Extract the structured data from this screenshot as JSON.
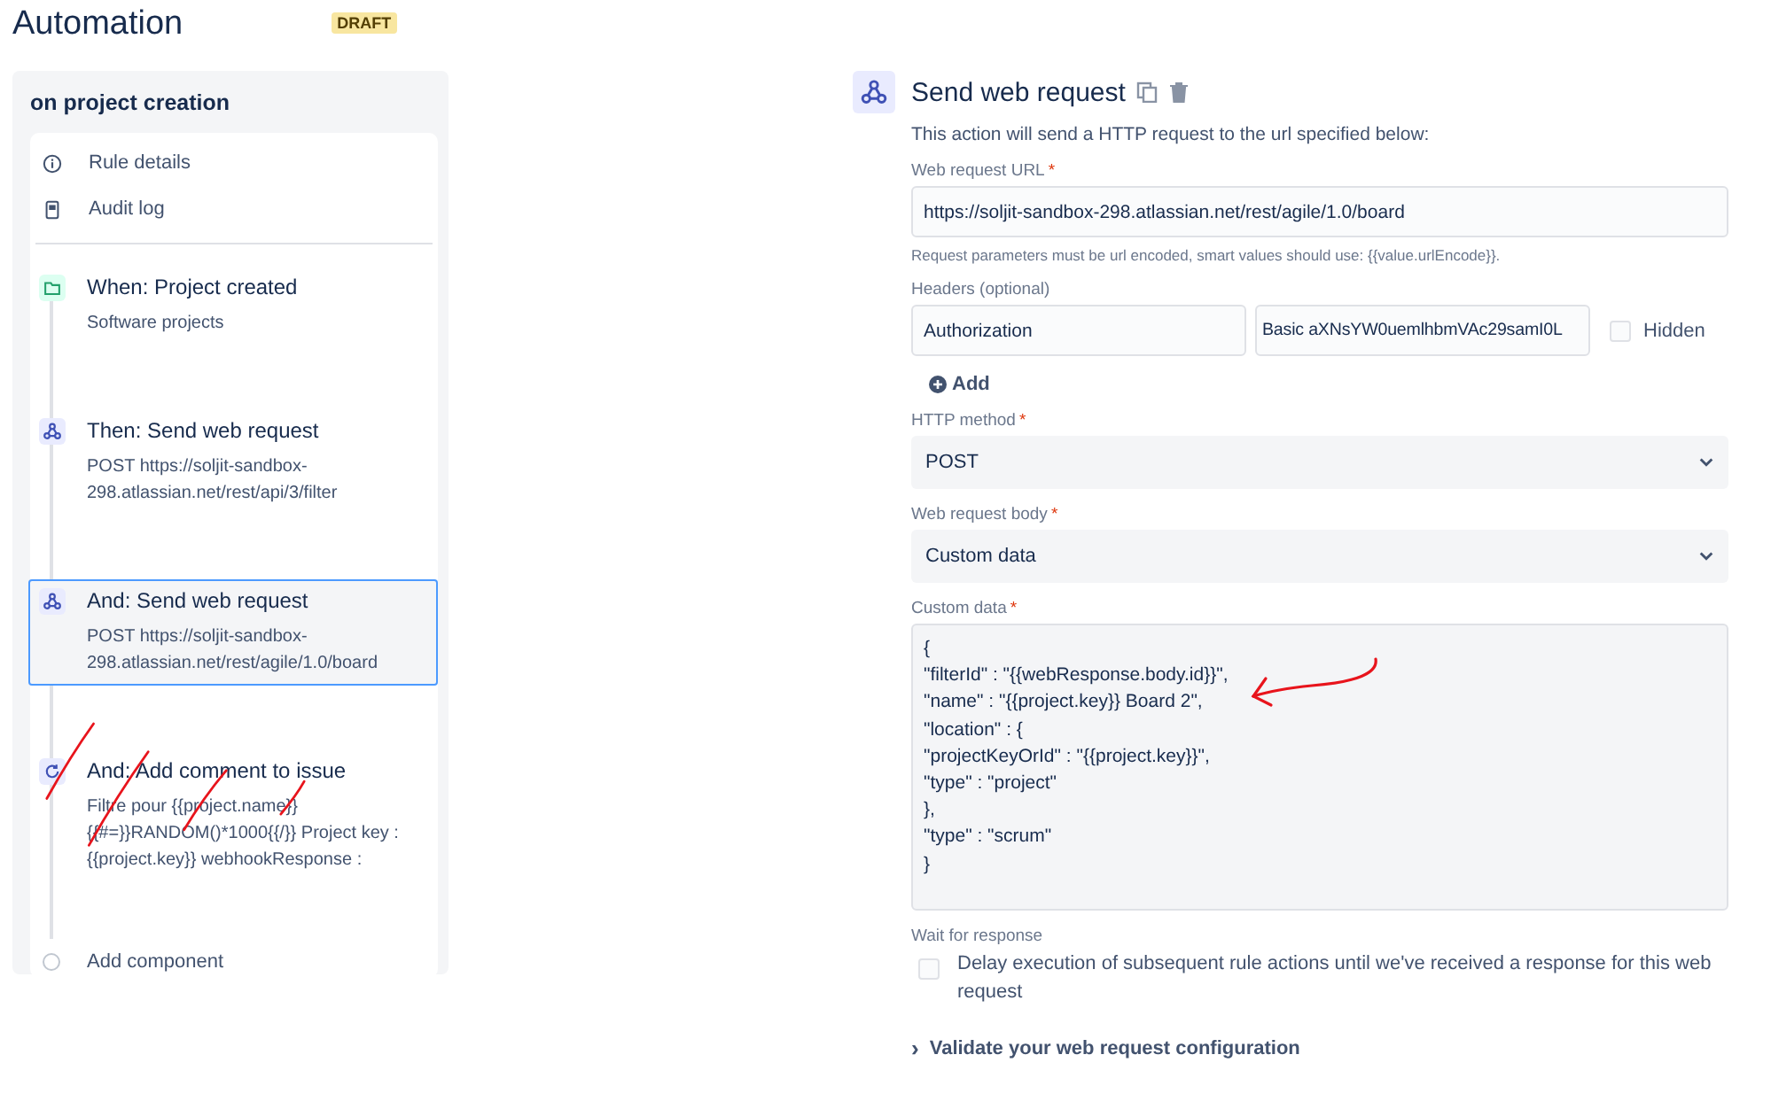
{
  "header": {
    "title": "Automation",
    "badge": "DRAFT"
  },
  "rule": {
    "name": "on project creation",
    "links": [
      {
        "kind": "info",
        "label": "Rule details"
      },
      {
        "kind": "log",
        "label": "Audit log"
      }
    ],
    "steps": [
      {
        "kind": "trigger",
        "title": "When: Project created",
        "detail": "Software projects",
        "selected": false
      },
      {
        "kind": "webhook",
        "title": "Then: Send web request",
        "detail": "POST https://soljit-sandbox-298.atlassian.net/rest/api/3/filter",
        "selected": false
      },
      {
        "kind": "webhook",
        "title": "And: Send web request",
        "detail": "POST https://soljit-sandbox-298.atlassian.net/rest/agile/1.0/board",
        "selected": true
      },
      {
        "kind": "comment",
        "title": "And: Add comment to issue",
        "detail": "Filtre pour {{project.name}} {{#=}}RANDOM()*1000{{/}} Project key : {{project.key}} webhookResponse :",
        "selected": false
      }
    ],
    "add_label": "Add component"
  },
  "editor": {
    "title": "Send web request",
    "description": "This action will send a HTTP request to the url specified below:",
    "url": {
      "label": "Web request URL",
      "mark": "*",
      "value": "https://soljit-sandbox-298.atlassian.net/rest/agile/1.0/board",
      "hint": "Request parameters must be url encoded, smart values should use: {{value.urlEncode}}."
    },
    "headers": {
      "label": "Headers (optional)",
      "name": "Authorization",
      "value": "Basic aXNsYW0uemlhbmVAc29samI0L",
      "hidden": {
        "label": "Hidden",
        "checked": false
      },
      "add_label": "Add"
    },
    "method": {
      "label": "HTTP method",
      "mark": "*",
      "value": "POST"
    },
    "body": {
      "label": "Web request body",
      "mark": "*",
      "value": "Custom data"
    },
    "custom": {
      "label": "Custom data",
      "mark": "*",
      "lines": [
        "{",
        "\"filterId\" : \"{{webResponse.body.id}}\",",
        "\"name\" : \"{{project.key}} Board 2\",",
        "\"location\" : {",
        "\"projectKeyOrId\" : \"{{project.key}}\",",
        "\"type\" : \"project\"",
        "},",
        "\"type\" : \"scrum\"",
        "}"
      ]
    },
    "wait": {
      "label": "Wait for response",
      "option": "Delay execution of subsequent rule actions until we've received a response for this web request",
      "checked": false
    },
    "validate": "Validate your web request configuration",
    "chevron": "›"
  }
}
